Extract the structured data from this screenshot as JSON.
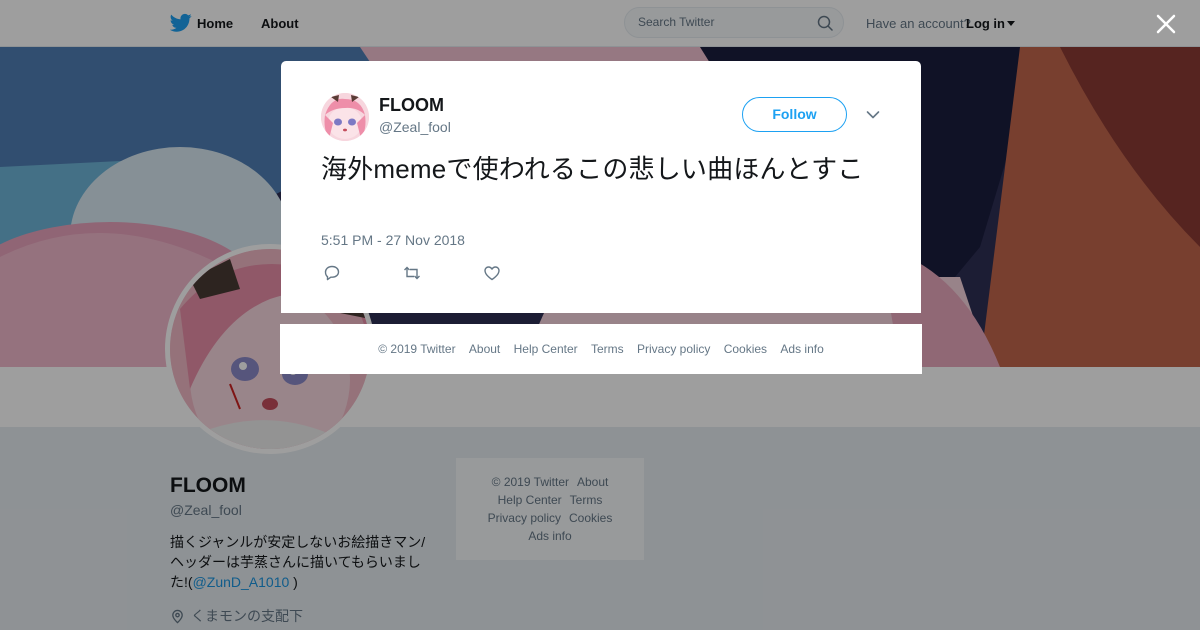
{
  "nav": {
    "home_label": "Home",
    "about_label": "About",
    "search_placeholder": "Search Twitter",
    "account_prompt": "Have an account?",
    "login_label": "Log in",
    "brand_color": "#1da1f2"
  },
  "profile": {
    "name": "FLOOM",
    "handle": "@Zeal_fool",
    "bio_text": "描くジャンルが安定しないお絵描きマン/ヘッダーは芋蒸さんに描いてもらいました!(",
    "bio_link": "@ZunD_A1010",
    "bio_end": " )",
    "location": "くまモンの支配下"
  },
  "side_footer": {
    "copyright": "© 2019 Twitter",
    "about": "About",
    "help": "Help Center",
    "terms": "Terms",
    "privacy": "Privacy policy",
    "cookies": "Cookies",
    "ads": "Ads info"
  },
  "tweet": {
    "name": "FLOOM",
    "handle": "@Zeal_fool",
    "follow_label": "Follow",
    "text": "海外memeで使われるこの悲しい曲ほんとすこ",
    "timestamp": "5:51 PM - 27 Nov 2018",
    "icons": [
      "reply-icon",
      "retweet-icon",
      "like-icon"
    ]
  },
  "modal_footer": {
    "copyright": "© 2019 Twitter",
    "about": "About",
    "help": "Help Center",
    "terms": "Terms",
    "privacy": "Privacy policy",
    "cookies": "Cookies",
    "ads": "Ads info"
  }
}
